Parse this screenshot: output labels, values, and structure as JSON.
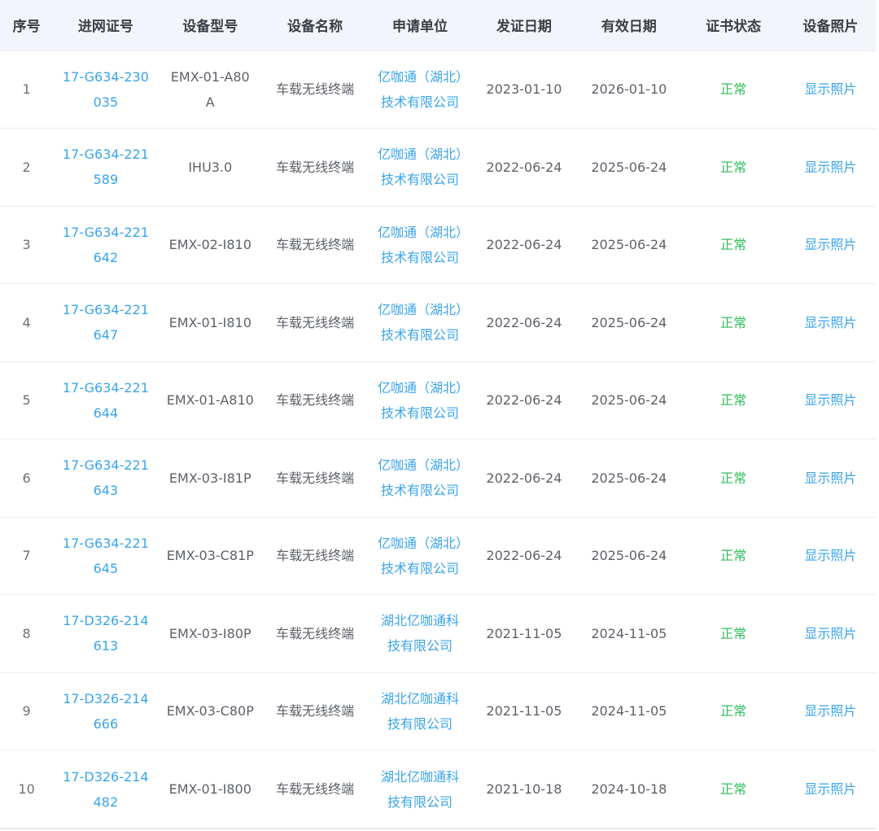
{
  "table": {
    "headers": [
      "序号",
      "进网证号",
      "设备型号",
      "设备名称",
      "申请单位",
      "发证日期",
      "有效日期",
      "证书状态",
      "设备照片"
    ],
    "rows": [
      {
        "idx": "1",
        "cert": "17-G634-230035",
        "model": "EMX-01-A80A",
        "name": "车载无线终端",
        "unit": "亿咖通（湖北）技术有限公司",
        "issue": "2023-01-10",
        "valid": "2026-01-10",
        "status": "正常",
        "photo": "显示照片"
      },
      {
        "idx": "2",
        "cert": "17-G634-221589",
        "model": "IHU3.0",
        "name": "车载无线终端",
        "unit": "亿咖通（湖北）技术有限公司",
        "issue": "2022-06-24",
        "valid": "2025-06-24",
        "status": "正常",
        "photo": "显示照片"
      },
      {
        "idx": "3",
        "cert": "17-G634-221642",
        "model": "EMX-02-I810",
        "name": "车载无线终端",
        "unit": "亿咖通（湖北）技术有限公司",
        "issue": "2022-06-24",
        "valid": "2025-06-24",
        "status": "正常",
        "photo": "显示照片"
      },
      {
        "idx": "4",
        "cert": "17-G634-221647",
        "model": "EMX-01-I810",
        "name": "车载无线终端",
        "unit": "亿咖通（湖北）技术有限公司",
        "issue": "2022-06-24",
        "valid": "2025-06-24",
        "status": "正常",
        "photo": "显示照片"
      },
      {
        "idx": "5",
        "cert": "17-G634-221644",
        "model": "EMX-01-A810",
        "name": "车载无线终端",
        "unit": "亿咖通（湖北）技术有限公司",
        "issue": "2022-06-24",
        "valid": "2025-06-24",
        "status": "正常",
        "photo": "显示照片"
      },
      {
        "idx": "6",
        "cert": "17-G634-221643",
        "model": "EMX-03-I81P",
        "name": "车载无线终端",
        "unit": "亿咖通（湖北）技术有限公司",
        "issue": "2022-06-24",
        "valid": "2025-06-24",
        "status": "正常",
        "photo": "显示照片"
      },
      {
        "idx": "7",
        "cert": "17-G634-221645",
        "model": "EMX-03-C81P",
        "name": "车载无线终端",
        "unit": "亿咖通（湖北）技术有限公司",
        "issue": "2022-06-24",
        "valid": "2025-06-24",
        "status": "正常",
        "photo": "显示照片"
      },
      {
        "idx": "8",
        "cert": "17-D326-214613",
        "model": "EMX-03-I80P",
        "name": "车载无线终端",
        "unit": "湖北亿咖通科技有限公司",
        "issue": "2021-11-05",
        "valid": "2024-11-05",
        "status": "正常",
        "photo": "显示照片"
      },
      {
        "idx": "9",
        "cert": "17-D326-214666",
        "model": "EMX-03-C80P",
        "name": "车载无线终端",
        "unit": "湖北亿咖通科技有限公司",
        "issue": "2021-11-05",
        "valid": "2024-11-05",
        "status": "正常",
        "photo": "显示照片"
      },
      {
        "idx": "10",
        "cert": "17-D326-214482",
        "model": "EMX-01-I800",
        "name": "车载无线终端",
        "unit": "湖北亿咖通科技有限公司",
        "issue": "2021-10-18",
        "valid": "2024-10-18",
        "status": "正常",
        "photo": "显示照片"
      }
    ]
  },
  "colors": {
    "header_bg": "#f2f6fb",
    "link": "#3aa4ec",
    "status_normal": "#2fbf5a",
    "text": "#5d6168"
  }
}
